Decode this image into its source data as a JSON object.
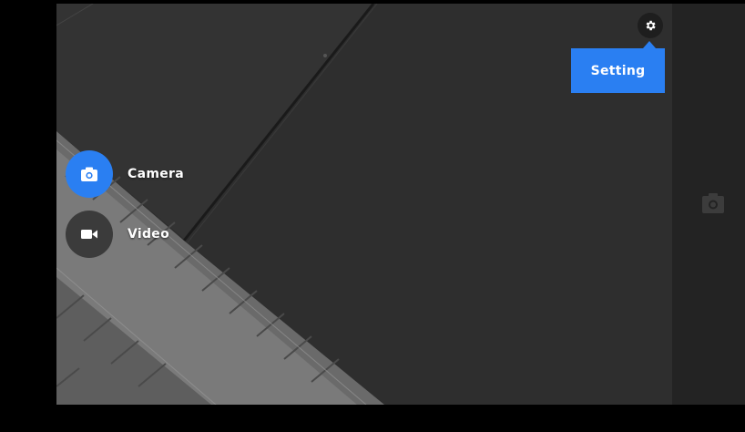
{
  "modes": {
    "items": [
      {
        "label": "Camera",
        "icon": "camera-icon",
        "selected": true
      },
      {
        "label": "Video",
        "icon": "video-icon",
        "selected": false
      }
    ]
  },
  "settings": {
    "icon": "gear-icon",
    "tooltip": "Setting"
  },
  "side_rail": {
    "icon": "shutter-camera-icon"
  },
  "colors": {
    "accent": "#2a7ff2",
    "viewfinder": "#2b2b2b",
    "rail": "#232323",
    "inactive_button": "#3b3b3b"
  }
}
